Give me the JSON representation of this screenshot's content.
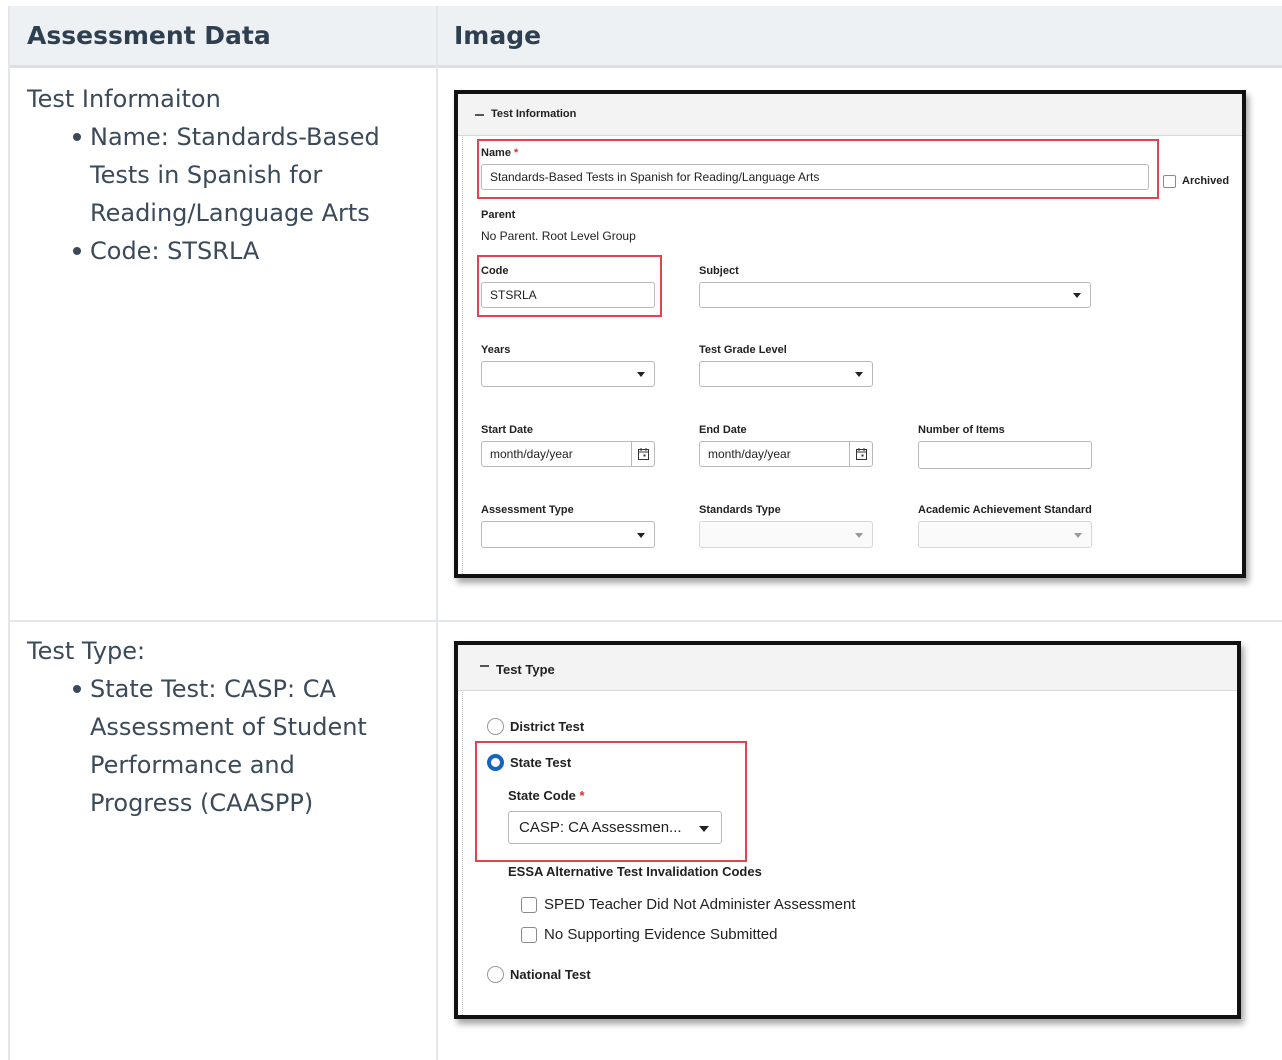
{
  "table": {
    "col1_header": "Assessment Data",
    "col2_header": "Image"
  },
  "row1": {
    "title": "Test Informaiton",
    "items": [
      "Name: Standards-Based Tests in Spanish for Reading/Language Arts",
      "Code: STSRLA"
    ],
    "item1_lines": [
      "Name: Standards-Based",
      "Tests in Spanish for",
      "Reading/Language Arts"
    ],
    "item2": "Code: STSRLA"
  },
  "row2": {
    "title": "Test Type:",
    "item1_lines": [
      "State Test: CASP: CA",
      "Assessment of Student",
      "Performance and",
      "Progress (CAASPP)"
    ]
  },
  "test_info": {
    "section_title": "Test Information",
    "name_label": "Name",
    "name_value": "Standards-Based Tests in Spanish for Reading/Language Arts",
    "archived_label": "Archived",
    "parent_label": "Parent",
    "parent_value": "No Parent. Root Level Group",
    "code_label": "Code",
    "code_value": "STSRLA",
    "subject_label": "Subject",
    "years_label": "Years",
    "grade_label": "Test Grade Level",
    "start_label": "Start Date",
    "start_placeholder": "month/day/year",
    "end_label": "End Date",
    "end_placeholder": "month/day/year",
    "items_label": "Number of Items",
    "assessment_type_label": "Assessment Type",
    "standards_type_label": "Standards Type",
    "achievement_label": "Academic Achievement Standard",
    "required_mark": "*"
  },
  "test_type": {
    "section_title": "Test Type",
    "district_label": "District Test",
    "state_label": "State Test",
    "state_code_label": "State Code",
    "state_code_value": "CASP: CA Assessmen...",
    "essa_label": "ESSA Alternative Test Invalidation Codes",
    "check1_label": "SPED Teacher Did Not Administer Assessment",
    "check2_label": "No Supporting Evidence Submitted",
    "national_label": "National Test",
    "required_mark": "*",
    "selected": "State Test"
  },
  "colors": {
    "highlight": "#e0454d",
    "radio_selected": "#1565c0",
    "header_bg": "#eef1f4"
  }
}
